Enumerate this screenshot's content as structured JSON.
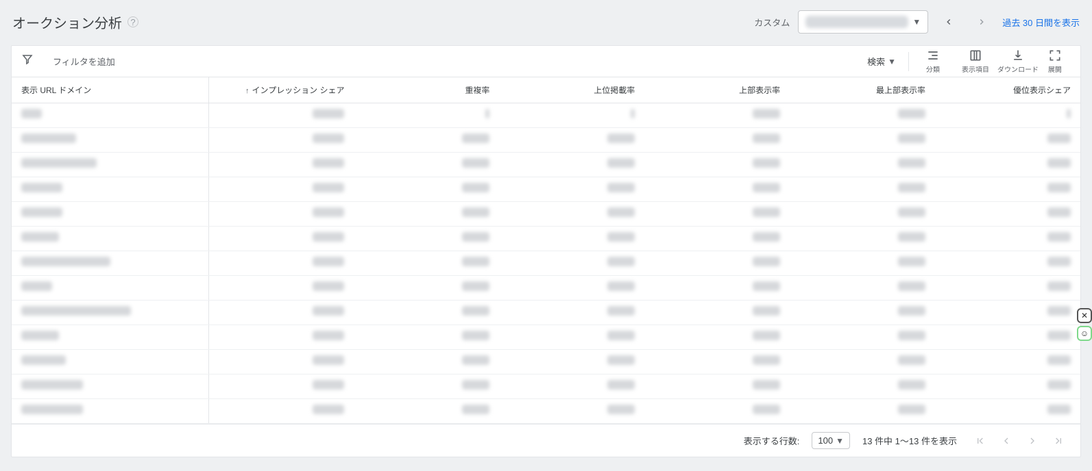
{
  "header": {
    "title": "オークション分析",
    "help_tooltip": "?",
    "custom_label": "カスタム",
    "show_last_30": "過去 30 日間を表示"
  },
  "toolbar": {
    "add_filter": "フィルタを追加",
    "search": "検索",
    "segment": "分類",
    "columns": "表示項目",
    "download": "ダウンロード",
    "expand": "展開"
  },
  "table": {
    "headers": {
      "domain": "表示 URL ドメイン",
      "impr_share": "インプレッション シェア",
      "overlap_rate": "重複率",
      "position_above": "上位掲載率",
      "top_of_page": "上部表示率",
      "abs_top": "最上部表示率",
      "outranking_share": "優位表示シェア"
    },
    "sort_indicator": "↑",
    "row_count": 13
  },
  "pager": {
    "rows_label": "表示する行数:",
    "rows_value": "100",
    "range_text": "13 件中 1～13 件を表示"
  }
}
